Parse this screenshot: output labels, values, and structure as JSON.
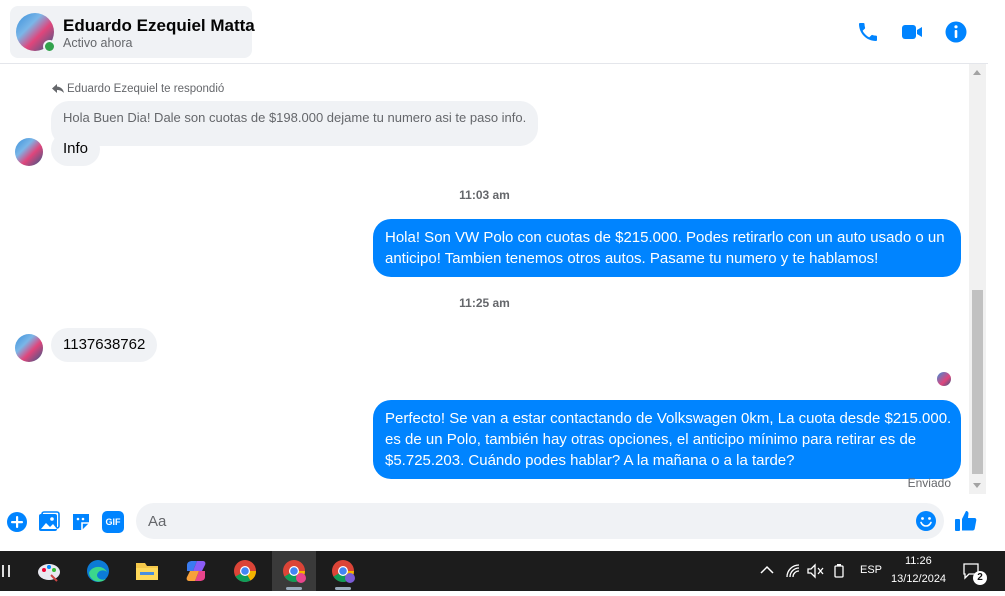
{
  "header": {
    "contact_name": "Eduardo Ezequiel Matta",
    "contact_status": "Activo ahora",
    "icons": [
      "phone-icon",
      "video-camera-icon",
      "info-icon"
    ],
    "accent_color": "#0084ff",
    "online_color": "#31a24c"
  },
  "messages": {
    "reply_note": "Eduardo Ezequiel te respondió",
    "quoted_text": "Hola Buen Dia! Dale son cuotas de $198.000 dejame tu numero asi te paso info.",
    "msg_info": "Info",
    "time_1": "11:03 am",
    "out_1": "Hola! Son VW Polo con cuotas de $215.000. Podes retirarlo con un auto usado o un anticipo! Tambien tenemos otros autos. Pasame tu numero y te hablamos!",
    "time_2": "11:25 am",
    "msg_number": "1137638762",
    "out_2_line1": "Perfecto!  Se van a estar contactando de Volkswagen 0km, La cuota desde $215.000.",
    "out_2_line2": "es de un Polo, también hay otras opciones, el anticipo mínimo para retirar es de",
    "out_2_line3": "$5.725.203. Cuándo podes hablar? A la mañana o a la tarde?",
    "sent_label": "Enviado"
  },
  "composer": {
    "placeholder": "Aa",
    "icons": [
      "plus-icon",
      "photo-icon",
      "sticker-icon",
      "gif-icon",
      "emoji-icon",
      "thumbs-up-icon"
    ],
    "gif_label": "GIF"
  },
  "taskbar": {
    "apps": [
      "paint-app-icon",
      "edge-icon",
      "file-explorer-icon",
      "copilot-icon",
      "chrome-icon",
      "chrome-profile-icon",
      "chrome-profile-2-icon"
    ],
    "language": "ESP",
    "time": "11:26",
    "date": "13/12/2024",
    "notification_count": "2"
  }
}
